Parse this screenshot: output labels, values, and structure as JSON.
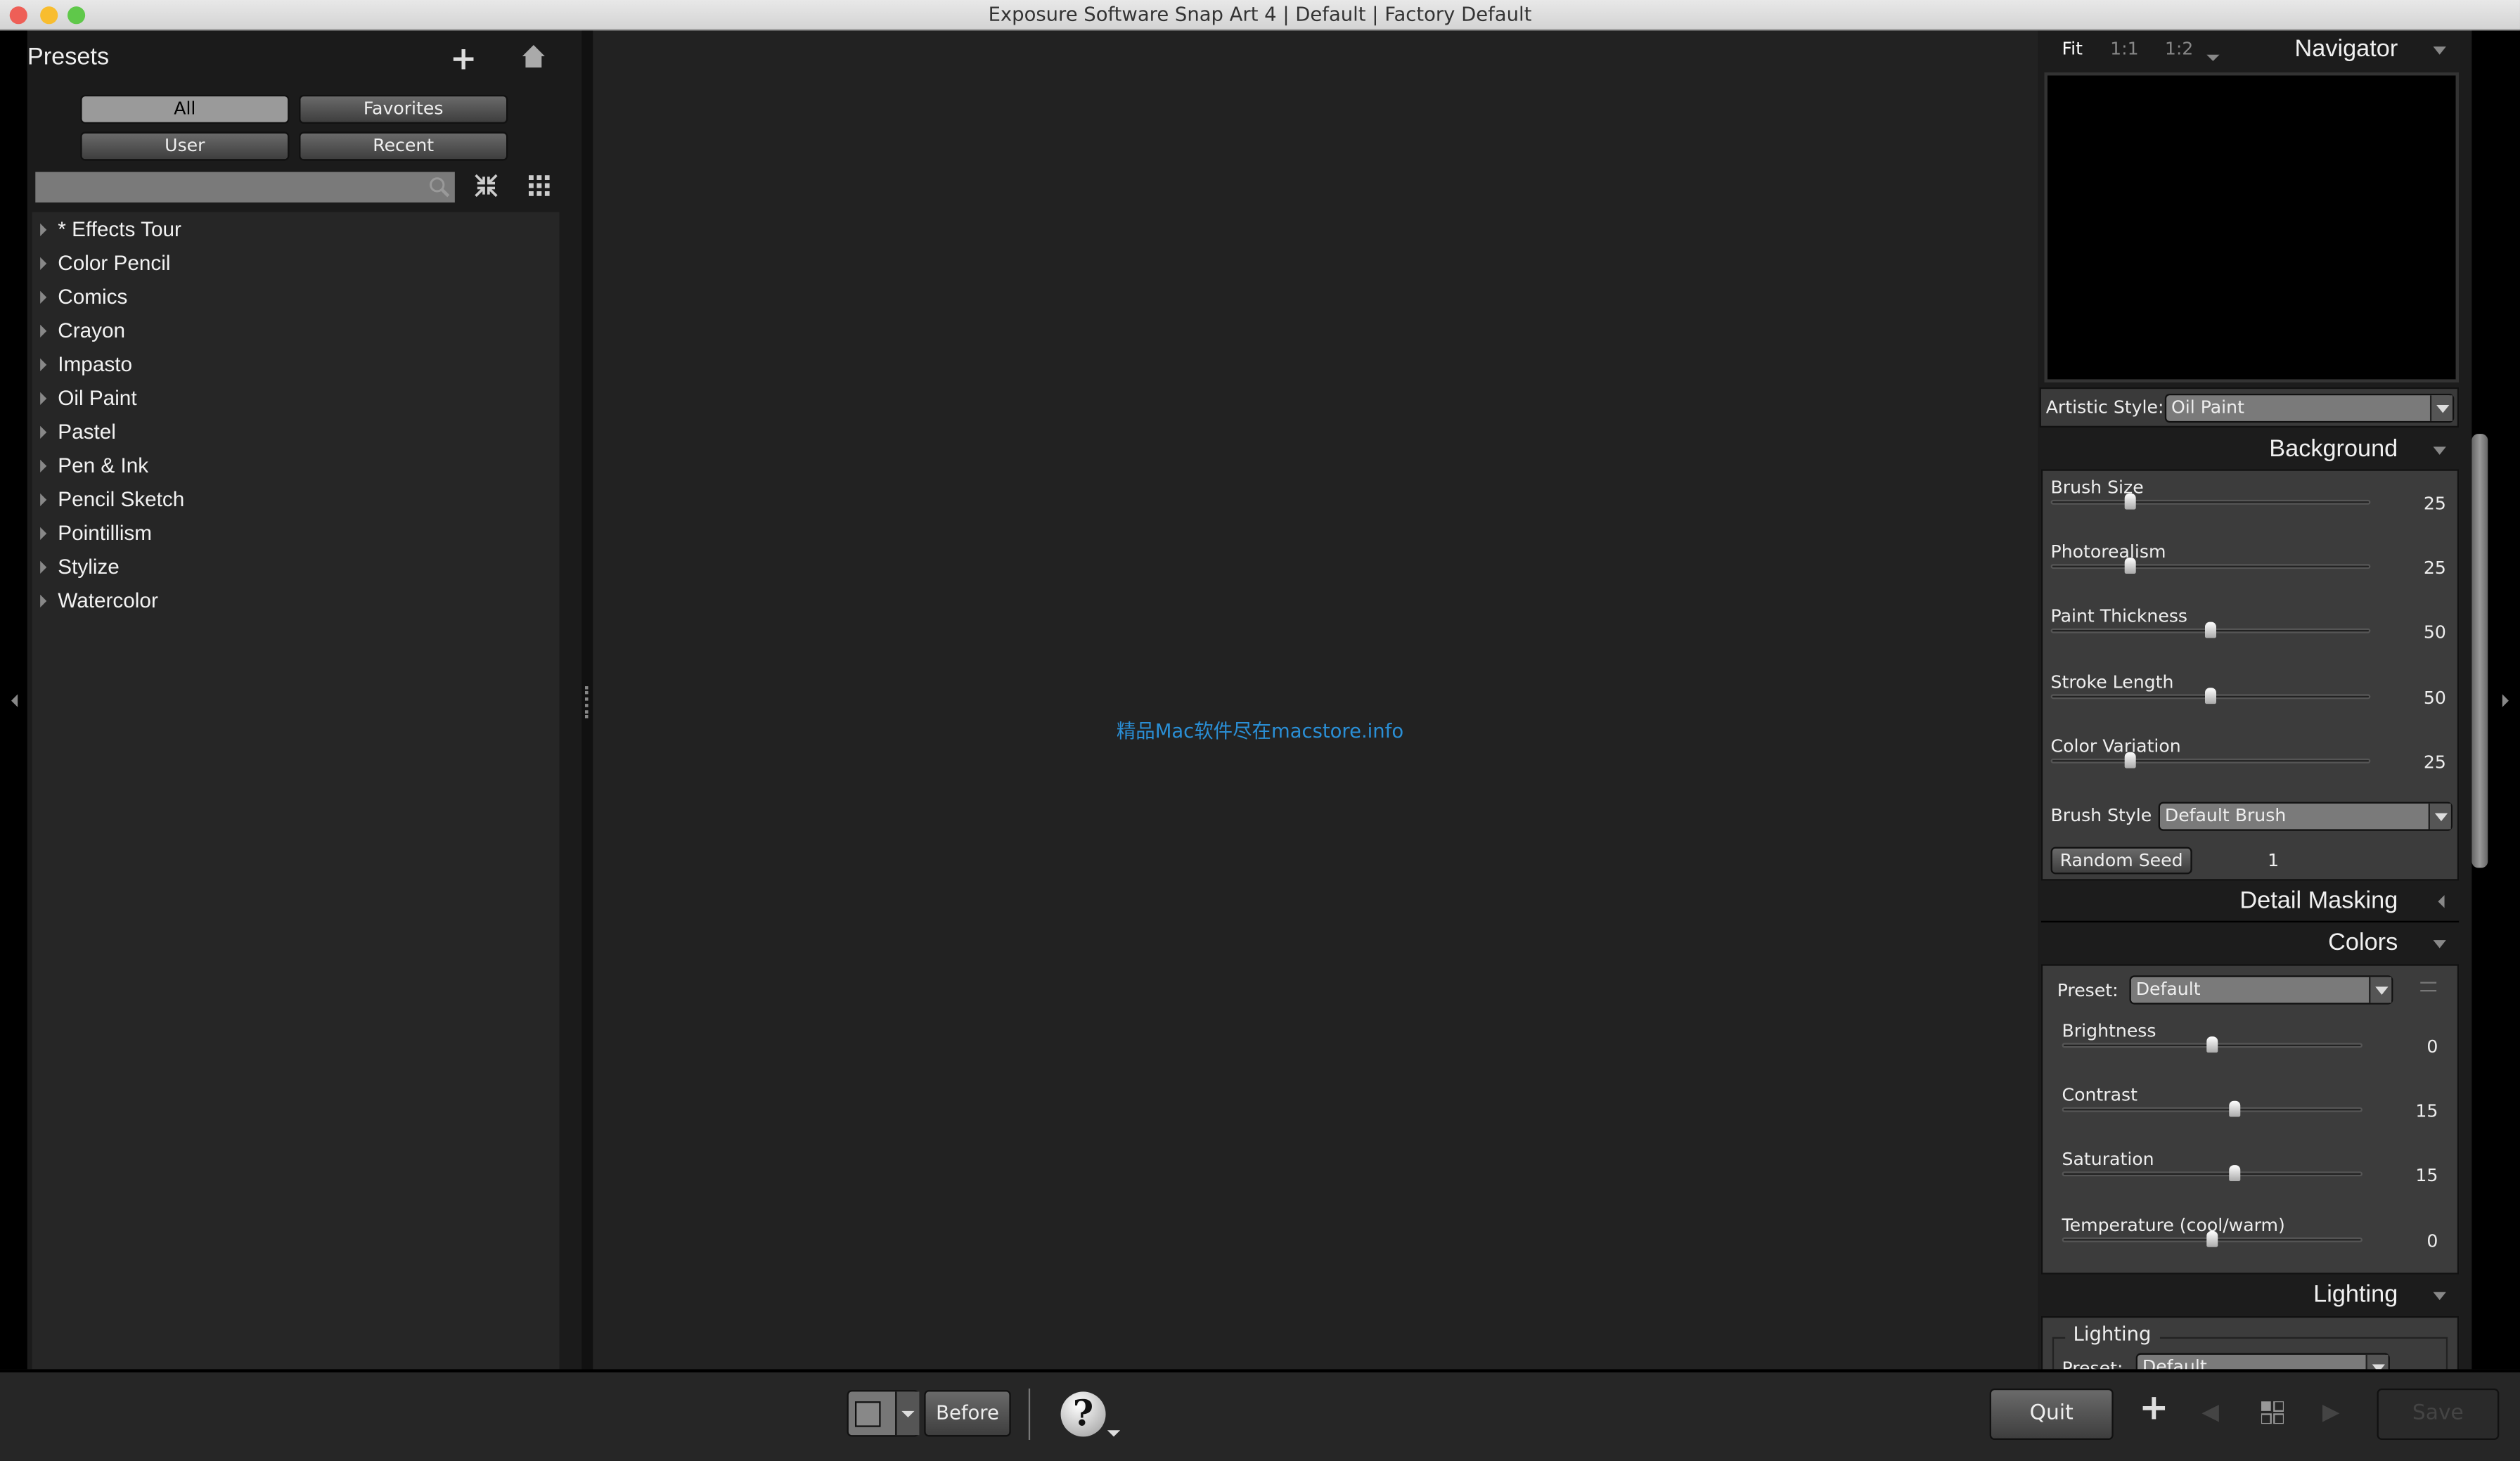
{
  "window": {
    "title": "Exposure Software Snap Art 4 | Default | Factory Default"
  },
  "presets": {
    "title": "Presets",
    "filters": [
      "All",
      "Favorites",
      "User",
      "Recent"
    ],
    "selected_filter": "All",
    "search": {
      "value": "",
      "placeholder": ""
    },
    "items": [
      "* Effects Tour",
      "Color Pencil",
      "Comics",
      "Crayon",
      "Impasto",
      "Oil Paint",
      "Pastel",
      "Pen & Ink",
      "Pencil Sketch",
      "Pointillism",
      "Stylize",
      "Watercolor"
    ]
  },
  "canvas": {
    "watermark": "精品Mac软件尽在macstore.info",
    "watermark_color": "#2a8fd6"
  },
  "navigator": {
    "title": "Navigator",
    "zoom_options": [
      "Fit",
      "1:1",
      "1:2"
    ],
    "selected_zoom": "Fit"
  },
  "artistic_style": {
    "label": "Artistic Style:",
    "value": "Oil Paint"
  },
  "background": {
    "title": "Background",
    "sliders": [
      {
        "label": "Brush Size",
        "value": 25,
        "min": 0,
        "max": 100
      },
      {
        "label": "Photorealism",
        "value": 25,
        "min": 0,
        "max": 100
      },
      {
        "label": "Paint Thickness",
        "value": 50,
        "min": 0,
        "max": 100
      },
      {
        "label": "Stroke Length",
        "value": 50,
        "min": 0,
        "max": 100
      },
      {
        "label": "Color Variation",
        "value": 25,
        "min": 0,
        "max": 100
      }
    ],
    "brush_style": {
      "label": "Brush Style",
      "value": "Default Brush"
    },
    "random_seed": {
      "label": "Random Seed",
      "value": "1"
    }
  },
  "detail_masking": {
    "title": "Detail Masking"
  },
  "colors": {
    "title": "Colors",
    "preset": {
      "label": "Preset:",
      "value": "Default"
    },
    "sliders": [
      {
        "label": "Brightness",
        "value": 0,
        "min": -100,
        "max": 100
      },
      {
        "label": "Contrast",
        "value": 15,
        "min": -100,
        "max": 100
      },
      {
        "label": "Saturation",
        "value": 15,
        "min": -100,
        "max": 100
      },
      {
        "label": "Temperature (cool/warm)",
        "value": 0,
        "min": -100,
        "max": 100
      }
    ]
  },
  "lighting": {
    "title": "Lighting",
    "group_label": "Lighting",
    "preset": {
      "label": "Preset:",
      "value": "Default"
    }
  },
  "bottom": {
    "before": "Before",
    "quit": "Quit",
    "save": "Save"
  }
}
